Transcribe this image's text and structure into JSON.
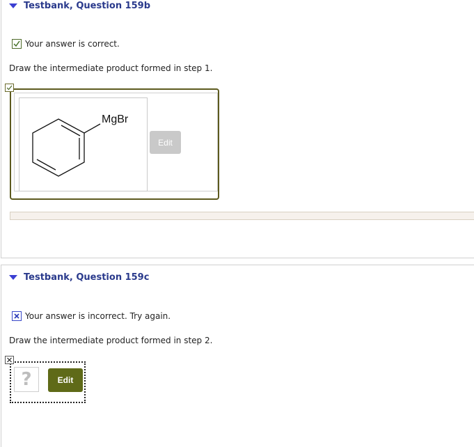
{
  "question_b": {
    "header": "Testbank, Question 159b",
    "status_text": "Your answer is correct.",
    "prompt": "Draw the intermediate product formed in step 1.",
    "molecule_label": "MgBr",
    "edit_label": "Edit"
  },
  "question_c": {
    "header": "Testbank, Question 159c",
    "status_text": "Your answer is incorrect.  Try again.",
    "prompt": "Draw the intermediate product formed in step 2.",
    "placeholder_glyph": "?",
    "edit_label": "Edit"
  },
  "colors": {
    "header_text": "#2a3a8c",
    "accent_triangle": "#3b3fd2",
    "correct_border": "#5d5a1e",
    "edit_active": "#5f6a18",
    "edit_disabled": "#c9c9c9"
  }
}
